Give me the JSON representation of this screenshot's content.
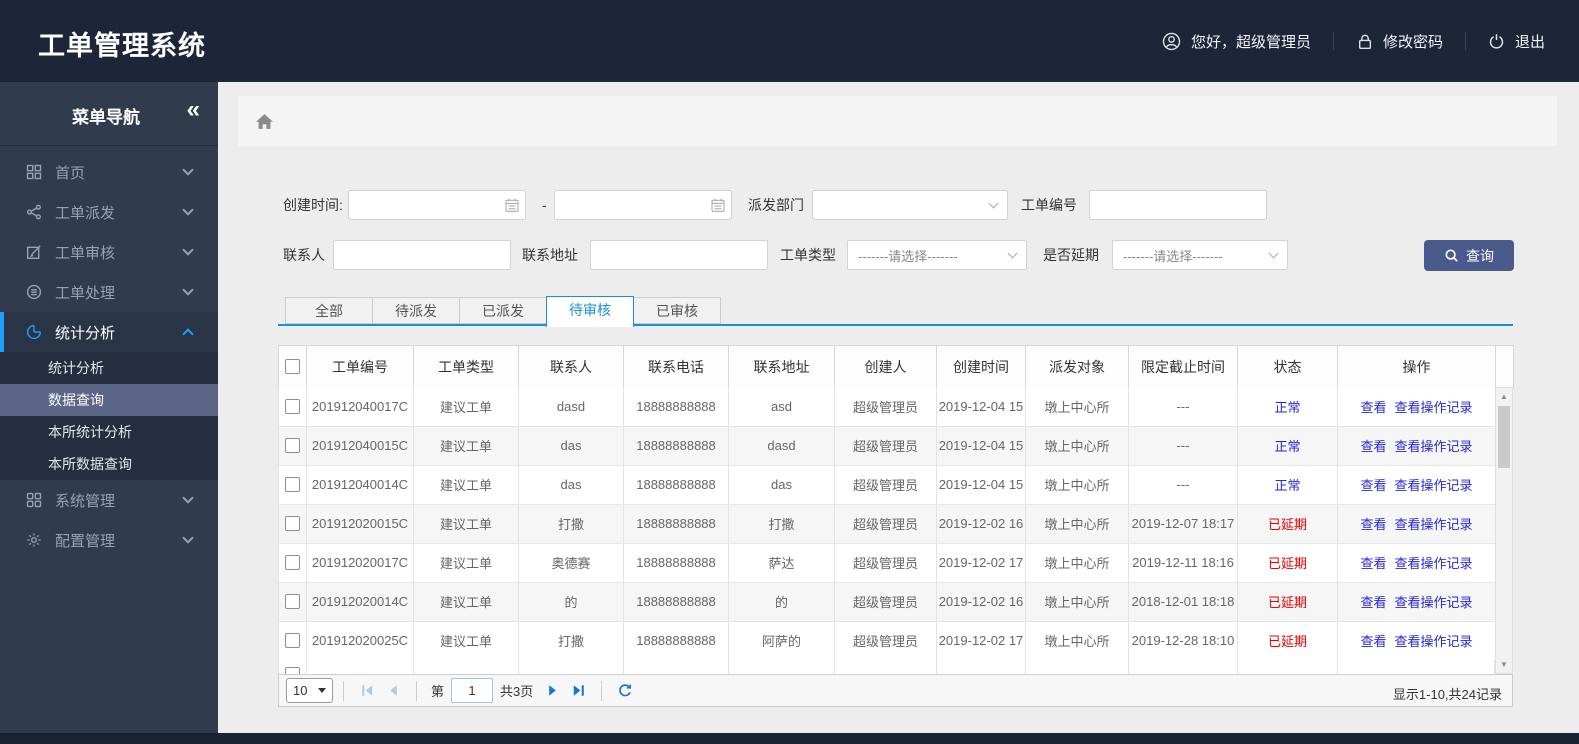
{
  "colors": {
    "accent_blue": "#1e9fff",
    "tab_blue": "#1890d8",
    "link_blue": "#2727d8",
    "status_red": "#e60000",
    "search_button_navy": "#4a5a8c",
    "header_bg": "#1c2638",
    "sidebar_bg": "#303b4e"
  },
  "header": {
    "title": "工单管理系统",
    "greeting": "您好，超级管理员",
    "change_password": "修改密码",
    "logout": "退出"
  },
  "sidebar": {
    "title": "菜单导航",
    "collapse_icon": "«",
    "items": [
      {
        "label": "首页",
        "icon": "grid-icon"
      },
      {
        "label": "工单派发",
        "icon": "share-icon"
      },
      {
        "label": "工单审核",
        "icon": "edit-icon"
      },
      {
        "label": "工单处理",
        "icon": "list-circle-icon"
      },
      {
        "label": "统计分析",
        "icon": "pie-chart-icon",
        "active": true,
        "children": [
          {
            "label": "统计分析"
          },
          {
            "label": "数据查询",
            "selected": true
          },
          {
            "label": "本所统计分析"
          },
          {
            "label": "本所数据查询"
          }
        ]
      },
      {
        "label": "系统管理",
        "icon": "apps-icon"
      },
      {
        "label": "配置管理",
        "icon": "gear-icon"
      }
    ]
  },
  "filters": {
    "created_time_label": "创建时间:",
    "range_separator": "-",
    "dispatch_dept_label": "派发部门",
    "order_no_label": "工单编号",
    "contact_label": "联系人",
    "address_label": "联系地址",
    "order_type_label": "工单类型",
    "delay_label": "是否延期",
    "select_placeholder": "-------请选择-------",
    "search_button_label": "查询"
  },
  "tabs": [
    {
      "label": "全部"
    },
    {
      "label": "待派发"
    },
    {
      "label": "已派发"
    },
    {
      "label": "待审核",
      "active": true
    },
    {
      "label": "已审核"
    }
  ],
  "table": {
    "columns": [
      "工单编号",
      "工单类型",
      "联系人",
      "联系电话",
      "联系地址",
      "创建人",
      "创建时间",
      "派发对象",
      "限定截止时间",
      "状态",
      "操作"
    ],
    "action_view": "查看",
    "action_log": "查看操作记录",
    "rows": [
      {
        "order_no": "201912040017C",
        "type": "建议工单",
        "contact": "dasd",
        "phone": "18888888888",
        "address": "asd",
        "creator": "超级管理员",
        "created": "2019-12-04 15",
        "dispatch_to": "墩上中心所",
        "deadline": "---",
        "status": "正常",
        "status_color": "blue"
      },
      {
        "order_no": "201912040015C",
        "type": "建议工单",
        "contact": "das",
        "phone": "18888888888",
        "address": "dasd",
        "creator": "超级管理员",
        "created": "2019-12-04 15",
        "dispatch_to": "墩上中心所",
        "deadline": "---",
        "status": "正常",
        "status_color": "blue"
      },
      {
        "order_no": "201912040014C",
        "type": "建议工单",
        "contact": "das",
        "phone": "18888888888",
        "address": "das",
        "creator": "超级管理员",
        "created": "2019-12-04 15",
        "dispatch_to": "墩上中心所",
        "deadline": "---",
        "status": "正常",
        "status_color": "blue"
      },
      {
        "order_no": "201912020015C",
        "type": "建议工单",
        "contact": "打撒",
        "phone": "18888888888",
        "address": "打撒",
        "creator": "超级管理员",
        "created": "2019-12-02 16",
        "dispatch_to": "墩上中心所",
        "deadline": "2019-12-07 18:17",
        "status": "已延期",
        "status_color": "red"
      },
      {
        "order_no": "201912020017C",
        "type": "建议工单",
        "contact": "奥德赛",
        "phone": "18888888888",
        "address": "萨达",
        "creator": "超级管理员",
        "created": "2019-12-02 17",
        "dispatch_to": "墩上中心所",
        "deadline": "2019-12-11 18:16",
        "status": "已延期",
        "status_color": "red"
      },
      {
        "order_no": "201912020014C",
        "type": "建议工单",
        "contact": "的",
        "phone": "18888888888",
        "address": "的",
        "creator": "超级管理员",
        "created": "2019-12-02 16",
        "dispatch_to": "墩上中心所",
        "deadline": "2018-12-01 18:18",
        "status": "已延期",
        "status_color": "red"
      },
      {
        "order_no": "201912020025C",
        "type": "建议工单",
        "contact": "打撒",
        "phone": "18888888888",
        "address": "阿萨的",
        "creator": "超级管理员",
        "created": "2019-12-02 17",
        "dispatch_to": "墩上中心所",
        "deadline": "2019-12-28 18:10",
        "status": "已延期",
        "status_color": "red"
      }
    ]
  },
  "pagination": {
    "page_size": "10",
    "page_prefix": "第",
    "page_value": "1",
    "total_pages": "共3页",
    "summary": "显示1-10,共24记录"
  }
}
